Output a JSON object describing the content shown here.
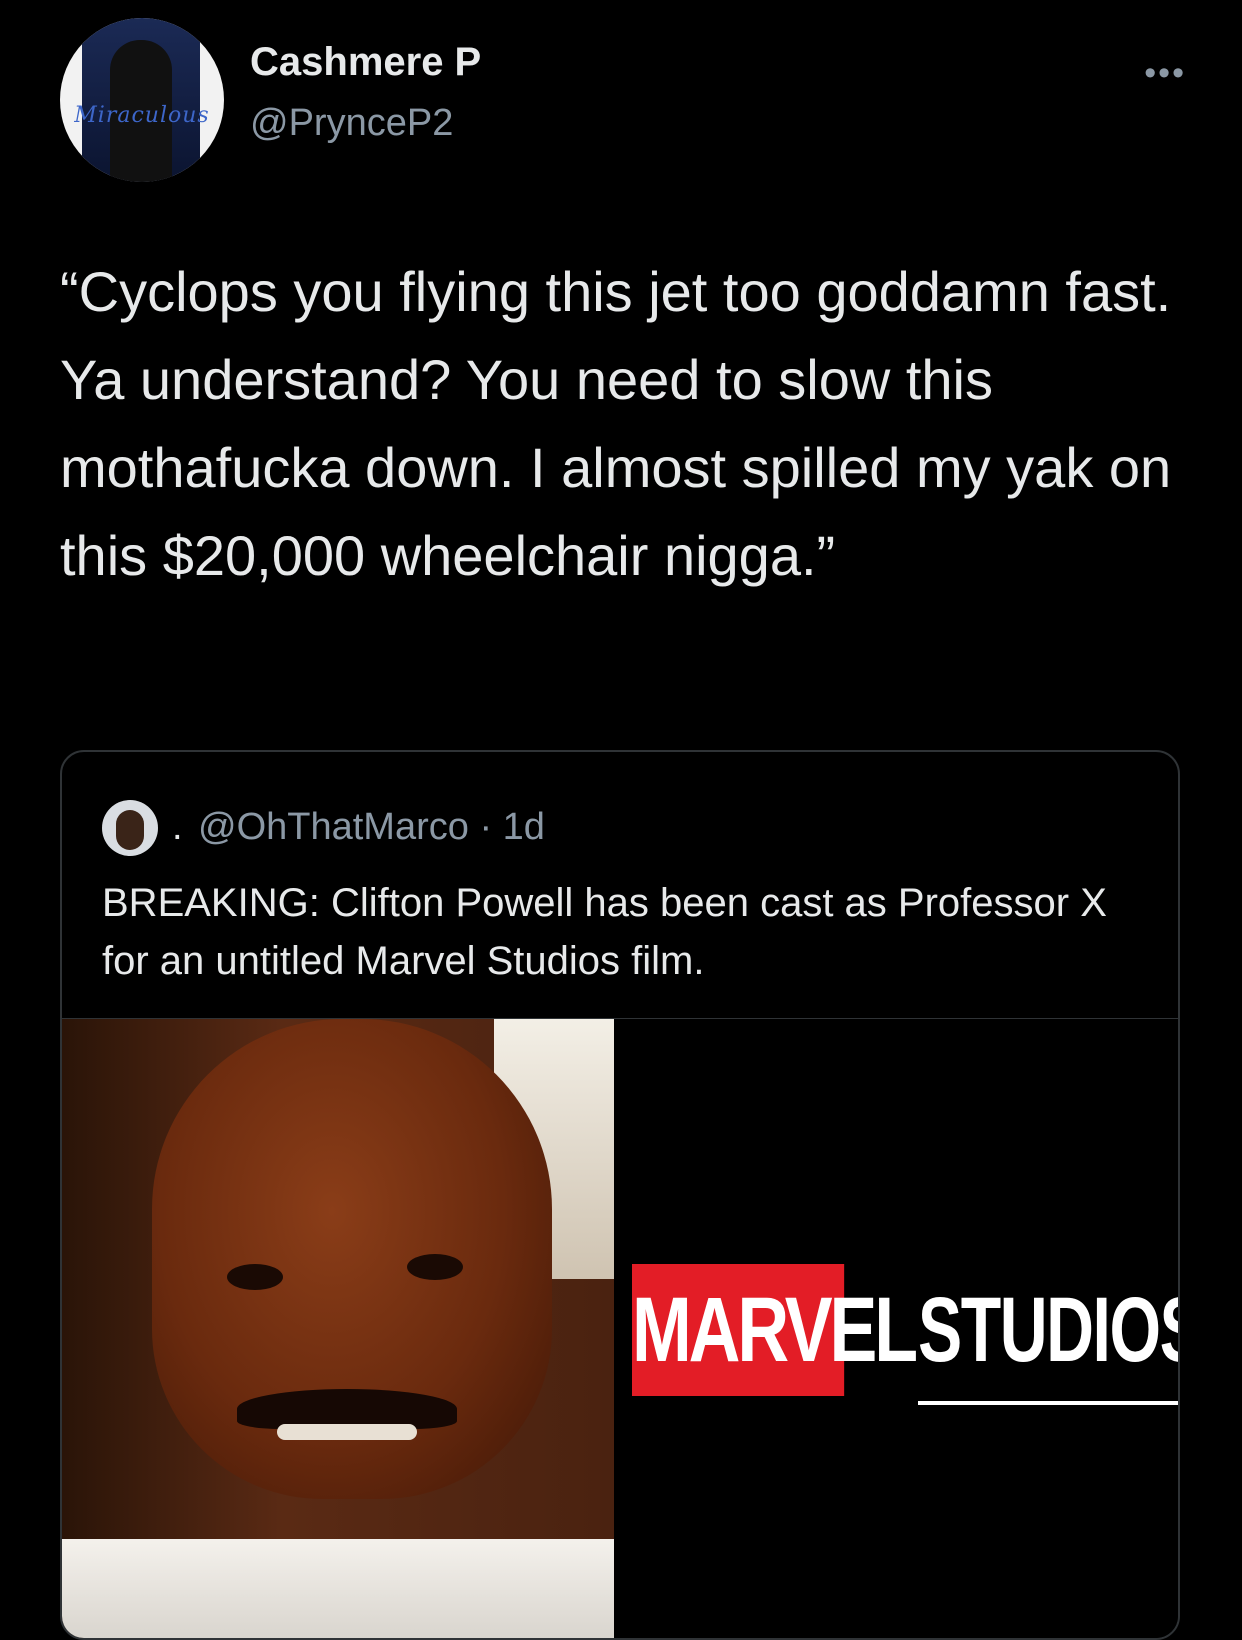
{
  "tweet": {
    "author": {
      "display_name": "Cashmere P",
      "handle": "@PrynceP2",
      "avatar_banner_text": "Miraculous"
    },
    "more_icon": "ellipsis-icon",
    "text": "“Cyclops you flying this jet too goddamn fast. Ya understand? You need to slow this mothafucka down. I almost spilled my yak on this $20,000 wheelchair nigga.”",
    "quoted_tweet": {
      "separator": ".",
      "handle_and_time": "@OhThatMarco · 1d",
      "text": "BREAKING: Clifton Powell has been cast as Professor X for an untitled Marvel Studios film.",
      "media": {
        "logo_red_text": "MARVEL",
        "logo_text": "STUDIOS",
        "logo_red_color": "#e31d26"
      }
    }
  }
}
